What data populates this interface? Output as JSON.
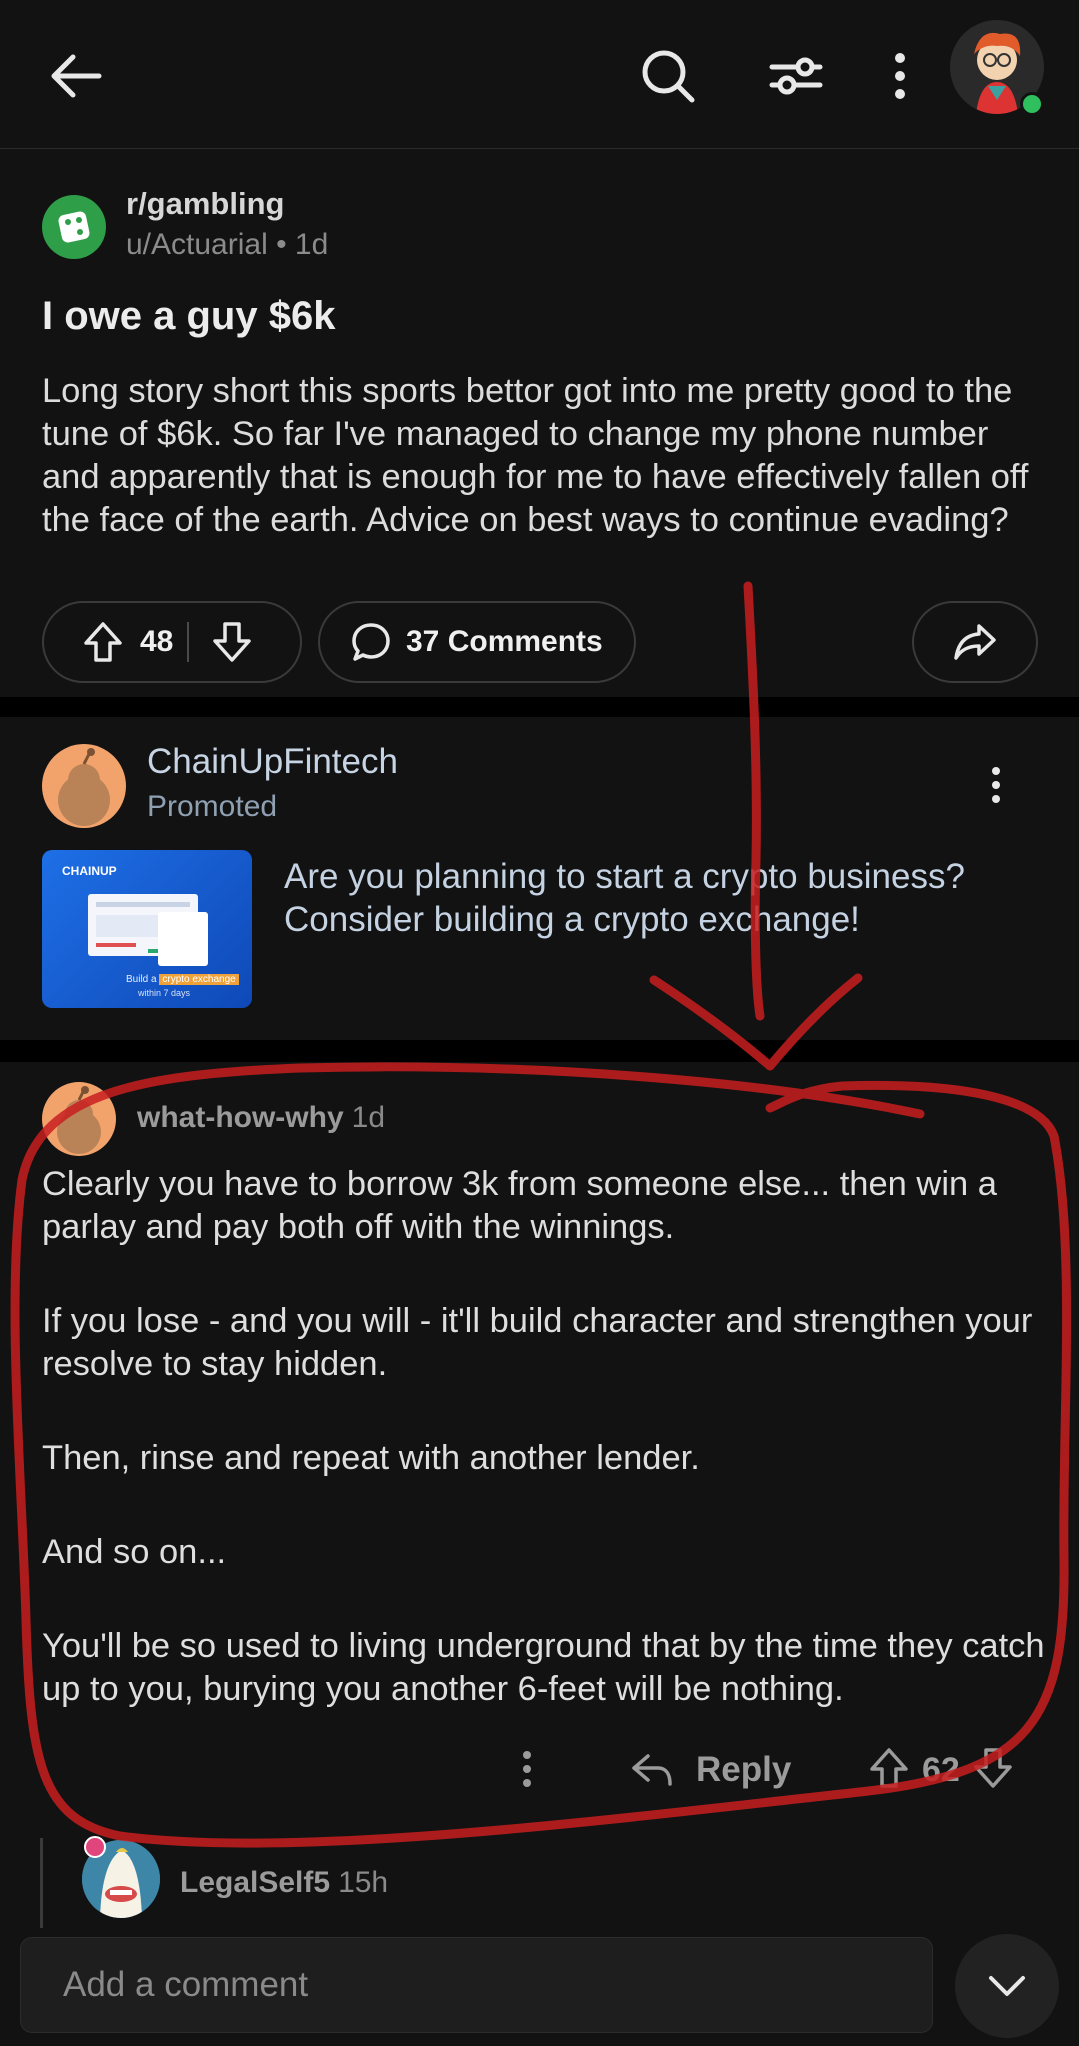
{
  "topbar": {
    "back_icon": "back-arrow-icon",
    "search_icon": "search-icon",
    "filter_icon": "sort-filter-icon",
    "more_icon": "more-vertical-icon",
    "avatar_icon": "user-avatar-icon",
    "online_color": "#2fbf5f"
  },
  "post": {
    "subreddit": "r/gambling",
    "author": "u/Actuarial",
    "age": "• 1d",
    "title": "I owe a guy $6k",
    "body": "Long story short this sports bettor got into me pretty good to the tune of $6k. So far I've managed to change my phone number and apparently that is enough for me to have effectively fallen off the face of the earth. Advice on best ways to continue evading?",
    "votes": "48",
    "comments_label": "37 Comments",
    "subreddit_color": "#2e9e48"
  },
  "ad": {
    "name": "ChainUpFintech",
    "promoted": "Promoted",
    "text": "Are you planning to start a crypto business? Consider building a crypto exchange!",
    "thumb_brand": "CHAINUP",
    "thumb_caption_1": "Build a",
    "thumb_caption_highlight": "crypto exchange",
    "thumb_caption_2": "within 7 days"
  },
  "comment": {
    "author": "what-how-why",
    "age": "1d",
    "paragraphs": [
      "Clearly you have to borrow 3k from someone else... then win a parlay and pay both off with the winnings.",
      "If you lose - and you will - it'll build character and strengthen your resolve to stay hidden.",
      "Then, rinse and repeat with another lender.",
      "And so on...",
      "You'll be so used to living underground that by the time they catch up to you, burying you another 6-feet will be nothing."
    ],
    "reply_label": "Reply",
    "votes": "62"
  },
  "reply": {
    "author": "LegalSelf5",
    "age": "15h"
  },
  "bottom": {
    "placeholder": "Add a comment"
  }
}
